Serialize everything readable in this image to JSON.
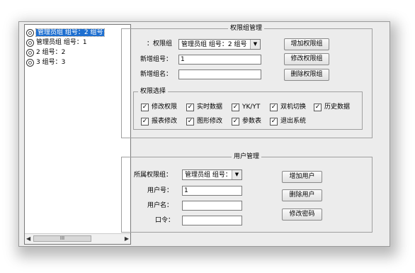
{
  "tree": {
    "items": [
      {
        "label": "管理员组  组号：2 组号"
      },
      {
        "label": "管理员组  组号：1"
      },
      {
        "label": "2 组号：2"
      },
      {
        "label": "3 组号：3"
      }
    ],
    "scroll_thumb": "III"
  },
  "permission_group": {
    "title": "权限组管理",
    "group_label": "：权限组",
    "group_value": "管理员组  组号：2 组号",
    "new_id_label": "新增组号：",
    "new_id_value": "1",
    "new_name_label": "新增组名：",
    "new_name_value": "",
    "buttons": {
      "add": "增加权限组",
      "modify": "修改权限组",
      "delete": "删除权限组"
    },
    "selection": {
      "title": "权限选择",
      "options": [
        {
          "label": "修改权限",
          "checked": true
        },
        {
          "label": "实时数据",
          "checked": true
        },
        {
          "label": "YK/YT",
          "checked": true
        },
        {
          "label": "双机切换",
          "checked": true
        },
        {
          "label": "历史数据",
          "checked": true
        },
        {
          "label": "报表修改",
          "checked": true
        },
        {
          "label": "图形修改",
          "checked": true
        },
        {
          "label": "参数表",
          "checked": true
        },
        {
          "label": "退出系统",
          "checked": true
        }
      ]
    }
  },
  "user_management": {
    "title": "用户管理",
    "group_label": "所属权限组：",
    "group_value": "管理员组  组号：",
    "user_id_label": "用户号：",
    "user_id_value": "1",
    "user_name_label": "用户名：",
    "user_name_value": "",
    "password_label": "口令：",
    "password_value": "",
    "buttons": {
      "add": "增加用户",
      "delete": "删除用户",
      "change_password": "修改密码"
    }
  },
  "check_mark": "✓"
}
